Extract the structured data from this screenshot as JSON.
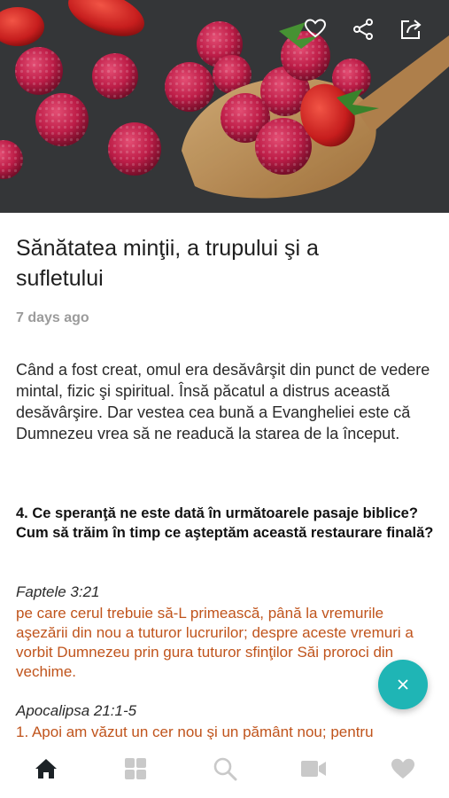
{
  "hero": {
    "image": "raspberries-and-strawberries-on-wooden-spoon",
    "actions": [
      {
        "icon": "heart-outline-icon"
      },
      {
        "icon": "share-nodes-icon"
      },
      {
        "icon": "external-share-icon"
      }
    ]
  },
  "article": {
    "title": "Sănătatea minţii, a trupului şi a sufletului",
    "date": "7 days ago",
    "intro": "Când a fost creat, omul era desăvârşit din punct de vedere mintal, fizic şi spiritual. Însă păcatul a distrus această desăvârşire. Dar vestea cea bună a Evangheliei este că Dumnezeu vrea să ne readucă la starea de la început.",
    "question": "4. Ce speranţă ne este dată în următoarele pasaje biblice? Cum să trăim în timp ce aşteptăm această restaurare finală?",
    "passages": [
      {
        "ref": "Faptele 3:21",
        "text": "pe care cerul trebuie să-L primească, până la vremurile aşezării din nou a tuturor lucrurilor; despre aceste vremuri a vorbit Dumnezeu prin gura tuturor sfinţilor Săi proroci din vechime."
      },
      {
        "ref": "Apocalipsa 21:1-5",
        "text": "1. Apoi am văzut un cer nou şi un pământ nou; pentru"
      }
    ]
  },
  "fab": {
    "icon": "close-icon",
    "color": "#1fb5b5"
  },
  "colors": {
    "accent": "#1fb5b5",
    "verse": "#c0541c",
    "muted": "#9b9b9b"
  },
  "tabbar": [
    {
      "icon": "home-icon",
      "active": true
    },
    {
      "icon": "grid-icon",
      "active": false
    },
    {
      "icon": "search-icon",
      "active": false
    },
    {
      "icon": "video-camera-icon",
      "active": false
    },
    {
      "icon": "heart-icon",
      "active": false
    }
  ]
}
